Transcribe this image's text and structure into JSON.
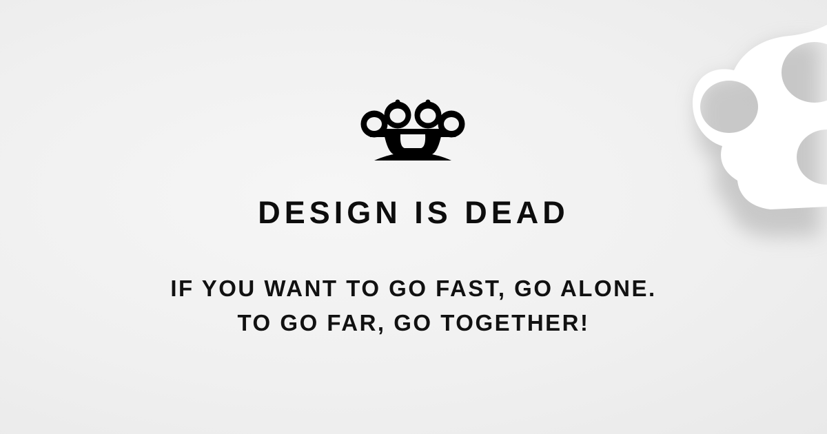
{
  "logo": {
    "icon": "brass-knuckles-icon",
    "color": "#000000"
  },
  "decoration": {
    "icon": "brass-knuckles-paper-cutout-icon",
    "color": "#ffffff"
  },
  "title": "DESIGN IS DEAD",
  "quote": {
    "line1": "IF YOU WANT TO GO FAST, GO ALONE.",
    "line2": "TO GO FAR, GO TOGETHER!"
  },
  "colors": {
    "background": "#f0f0f0",
    "text": "#111111"
  }
}
